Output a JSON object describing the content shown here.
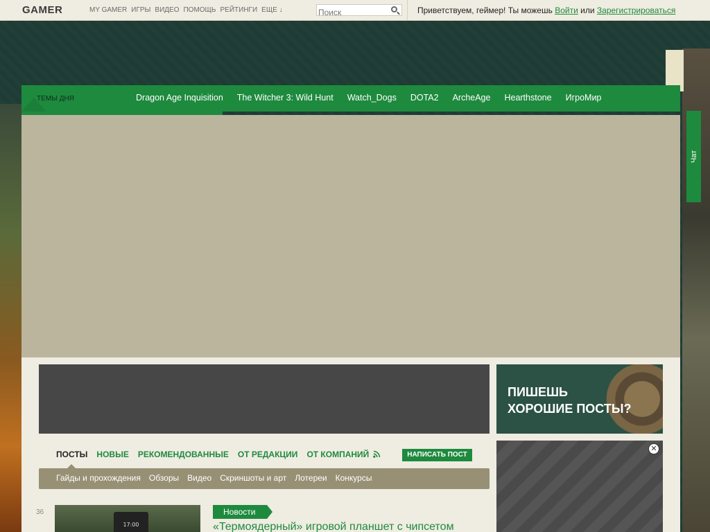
{
  "header": {
    "logo": "GAMER",
    "nav": [
      "MY GAMER",
      "ИГРЫ",
      "ВИДЕО",
      "ПОМОЩЬ",
      "РЕЙТИНГИ",
      "ЕЩЕ ↓"
    ],
    "search_placeholder": "Поиск",
    "greeting": "Приветствуем, геймер! Ты можешь",
    "login_link": "Войти",
    "or_text": "или",
    "register_link": "Зарегистрироваться"
  },
  "themes": {
    "label": "ТЕМЫ ДНЯ",
    "links": [
      "Dragon Age Inquisition",
      "The Witcher 3: Wild Hunt",
      "Watch_Dogs",
      "DOTA2",
      "ArcheAge",
      "Hearthstone",
      "ИгроМир"
    ]
  },
  "chat": {
    "label": "Чат"
  },
  "promo": {
    "line1": "ПИШЕШЬ",
    "line2": "ХОРОШИЕ ПОСТЫ?"
  },
  "posts": {
    "tabs": [
      "ПОСТЫ",
      "НОВЫЕ",
      "РЕКОМЕНДОВАННЫЕ",
      "ОТ РЕДАКЦИИ",
      "ОТ КОМПАНИЙ"
    ],
    "write_button": "НАПИСАТЬ ПОСТ",
    "subnav": [
      "Гайды и прохождения",
      "Обзоры",
      "Видео",
      "Скриншоты и арт",
      "Лотереи",
      "Конкурсы"
    ],
    "items": [
      {
        "count": "36",
        "category": "Новости",
        "title": "«Термоядерный» игровой планшет с чипсетом",
        "thumb_time": "17:00"
      }
    ]
  },
  "colors": {
    "accent": "#1e8a3e",
    "bg": "#1f3d35",
    "paper": "#efece1"
  }
}
